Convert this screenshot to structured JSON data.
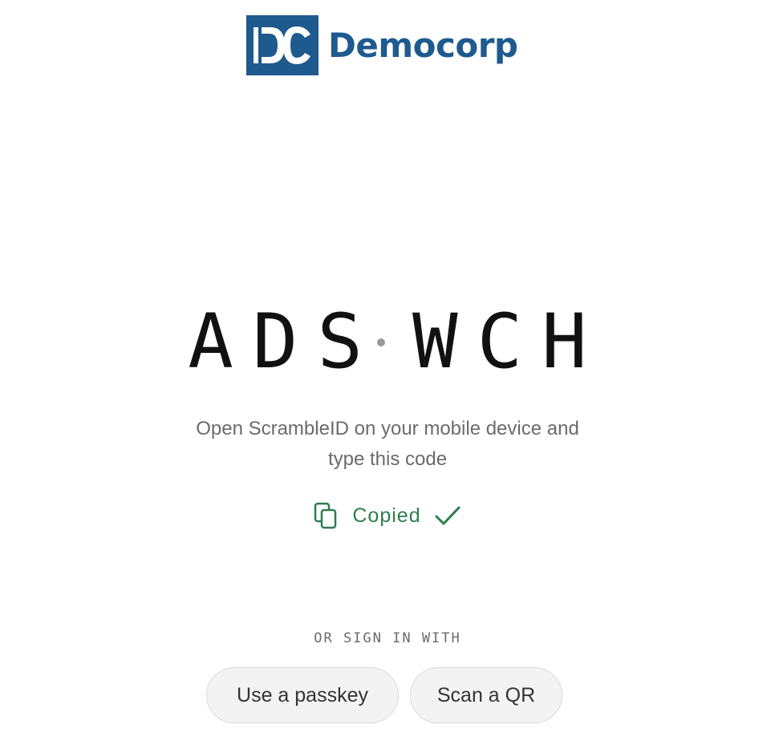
{
  "brand": {
    "name": "Democorp",
    "logo_mark_text": "DC",
    "color": "#1f5a8f"
  },
  "code": {
    "part1": "ADS",
    "part2": "WCH"
  },
  "instructions": {
    "line1": "Open ScrambleID on your mobile device and",
    "line2": "type this code"
  },
  "copy_status": {
    "label": "Copied",
    "icon": "copy-icon",
    "status_icon": "check-icon",
    "color": "#2e7d4f"
  },
  "alternatives": {
    "label": "OR SIGN IN WITH",
    "buttons": [
      {
        "label": "Use a passkey"
      },
      {
        "label": "Scan a QR"
      }
    ]
  }
}
